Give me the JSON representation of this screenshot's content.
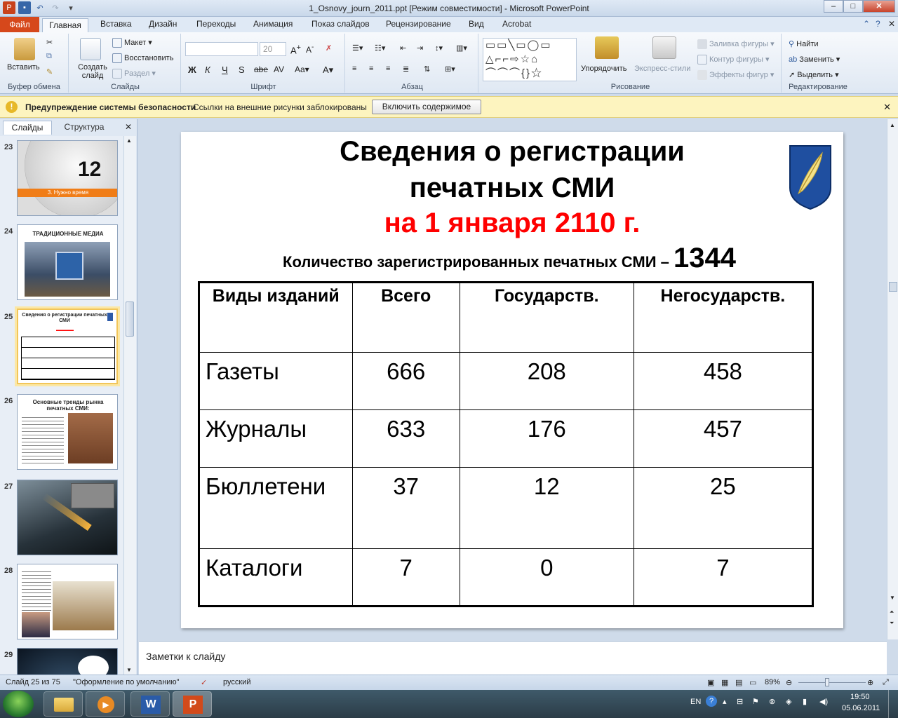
{
  "window": {
    "title": "1_Osnovy_journ_2011.ppt [Режим совместимости]  -  Microsoft PowerPoint"
  },
  "tabs": {
    "file": "Файл",
    "home": "Главная",
    "insert": "Вставка",
    "design": "Дизайн",
    "transitions": "Переходы",
    "animation": "Анимация",
    "slideshow": "Показ слайдов",
    "review": "Рецензирование",
    "view": "Вид",
    "acrobat": "Acrobat"
  },
  "ribbon": {
    "clipboard": {
      "paste": "Вставить",
      "label": "Буфер обмена"
    },
    "slides": {
      "new_slide": "Создать слайд",
      "layout": "Макет",
      "reset": "Восстановить",
      "section": "Раздел",
      "label": "Слайды"
    },
    "font": {
      "size": "20",
      "label": "Шрифт"
    },
    "paragraph": {
      "label": "Абзац"
    },
    "drawing": {
      "arrange": "Упорядочить",
      "quick_styles": "Экспресс-стили",
      "fill": "Заливка фигуры",
      "outline": "Контур фигуры",
      "effects": "Эффекты фигур",
      "label": "Рисование"
    },
    "editing": {
      "find": "Найти",
      "replace": "Заменить",
      "select": "Выделить",
      "label": "Редактирование"
    }
  },
  "security_bar": {
    "title": "Предупреждение системы безопасности",
    "message": "Ссылки на внешние рисунки заблокированы",
    "button": "Включить содержимое"
  },
  "left_panel": {
    "tab_slides": "Слайды",
    "tab_outline": "Структура",
    "thumbs": [
      {
        "num": "23",
        "caption": "3. Нужно время"
      },
      {
        "num": "24",
        "caption": "ТРАДИЦИОННЫЕ МЕДИА"
      },
      {
        "num": "25",
        "caption": "Сведения о регистрации печатных СМИ"
      },
      {
        "num": "26",
        "caption": "Основные тренды рынка печатных СМИ:"
      },
      {
        "num": "27",
        "caption": ""
      },
      {
        "num": "28",
        "caption": ""
      },
      {
        "num": "29",
        "caption": ""
      }
    ]
  },
  "slide": {
    "title_line1": "Сведения о регистрации",
    "title_line2": "печатных СМИ",
    "date_line": "на 1 января 2110 г.",
    "count_label": "Количество зарегистрированных печатных СМИ – ",
    "count_value": "1344",
    "table": {
      "headers": [
        "Виды изданий",
        "Всего",
        "Государств.",
        "Негосударств."
      ],
      "rows": [
        [
          "Газеты",
          "666",
          "208",
          "458"
        ],
        [
          "Журналы",
          "633",
          "176",
          "457"
        ],
        [
          "Бюллетени",
          "37",
          "12",
          "25"
        ],
        [
          "Каталоги",
          "7",
          "0",
          "7"
        ]
      ]
    }
  },
  "notes_placeholder": "Заметки к слайду",
  "status": {
    "slide_of": "Слайд 25 из 75",
    "theme": "\"Оформление по умолчанию\"",
    "language": "русский",
    "zoom": "89%"
  },
  "taskbar": {
    "lang": "EN",
    "time": "19:50",
    "date": "05.06.2011"
  },
  "colors": {
    "file_tab": "#d6481b",
    "red_text": "#ff0000",
    "security_bar": "#fdf4bf"
  }
}
